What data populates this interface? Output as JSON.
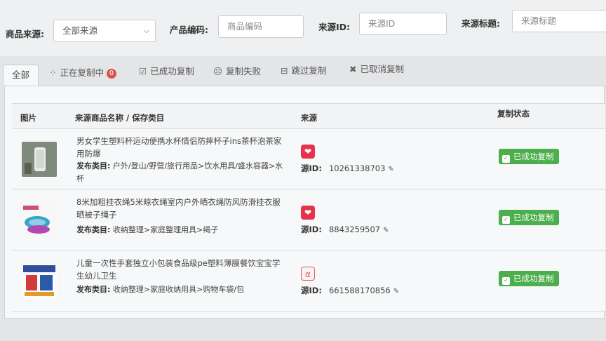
{
  "filters": {
    "source_label": "商品来源:",
    "source_value": "全部来源",
    "code_label": "产品编码:",
    "code_placeholder": "商品编码",
    "source_id_label": "来源ID:",
    "source_id_placeholder": "来源ID",
    "title_label": "来源标题:",
    "title_placeholder": "来源标题"
  },
  "tabs": [
    {
      "label": "全部",
      "icon": ""
    },
    {
      "label": "正在复制中",
      "icon": "spinner-icon",
      "badge": "0"
    },
    {
      "label": "已成功复制",
      "icon": "check-square-icon"
    },
    {
      "label": "复制失败",
      "icon": "frown-icon"
    },
    {
      "label": "跳过复制",
      "icon": "minus-square-icon"
    },
    {
      "label": "已取消复制",
      "icon": "times-icon"
    }
  ],
  "table": {
    "headers": {
      "image": "图片",
      "name": "来源商品名称 / 保存类目",
      "source": "来源",
      "status": "复制状态"
    },
    "rows": [
      {
        "name": "男女学生塑料杯运动便携水杯情侣防摔杯子ins茶杯泡茶家用防爆",
        "category_label": "发布类目:",
        "category": "户外/登山/野营/旅行用品>饮水用具/盛水容器>水杯",
        "source_icon": "pinduoduo-icon",
        "source_id_label": "源ID:",
        "source_id": "10261338703",
        "status": "已成功复制"
      },
      {
        "name": "8米加粗挂衣绳5米晾衣绳室内户外晒衣绳防风防滑挂衣服晒被子绳子",
        "category_label": "发布类目:",
        "category": "收纳整理>家庭整理用具>绳子",
        "source_icon": "pinduoduo-icon",
        "source_id_label": "源ID:",
        "source_id": "8843259507",
        "status": "已成功复制"
      },
      {
        "name": "儿童一次性手套独立小包装食品级pe塑料薄膜餐饮宝宝学生幼儿卫生",
        "category_label": "发布类目:",
        "category": "收纳整理>家庭收纳用具>购物车袋/包",
        "source_icon": "alibaba-icon",
        "source_id_label": "源ID:",
        "source_id": "661588170856",
        "status": "已成功复制"
      }
    ]
  },
  "colors": {
    "success": "#4cae4c",
    "badge": "#d9534f",
    "source_red": "#e6334a"
  }
}
